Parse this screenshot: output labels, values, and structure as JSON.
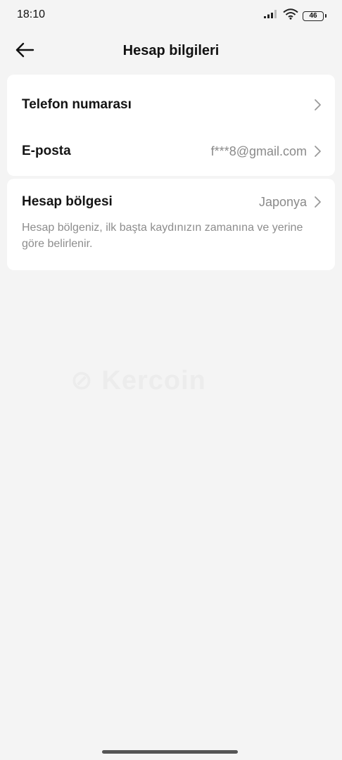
{
  "status_bar": {
    "time": "18:10",
    "battery_level": "46",
    "signal_icon": "cellular-signal-icon",
    "wifi_icon": "wifi-icon"
  },
  "header": {
    "title": "Hesap bilgileri",
    "back_icon": "arrow-left-icon"
  },
  "account_card": {
    "rows": [
      {
        "label": "Telefon numarası",
        "value": ""
      },
      {
        "label": "E-posta",
        "value": "f***8@gmail.com"
      }
    ]
  },
  "region_card": {
    "label": "Hesap bölgesi",
    "value": "Japonya",
    "description": "Hesap bölgeniz, ilk başta kaydınızın zamanına ve yerine göre belirlenir."
  },
  "colors": {
    "background": "#f4f4f4",
    "card": "#ffffff",
    "secondary_text": "#8a8a8a"
  }
}
